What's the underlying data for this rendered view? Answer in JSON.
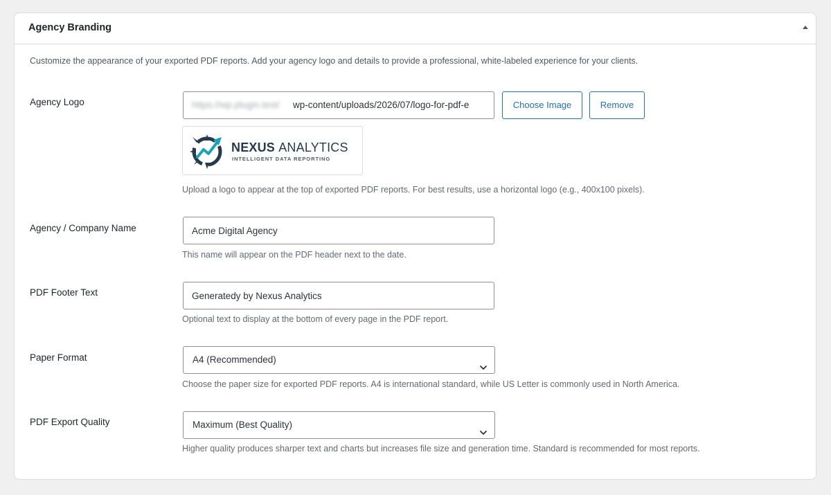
{
  "panel": {
    "title": "Agency Branding",
    "intro": "Customize the appearance of your exported PDF reports. Add your agency logo and details to provide a professional, white-labeled experience for your clients."
  },
  "agency_logo": {
    "label": "Agency Logo",
    "url_blurred": "https://wp.plugin.test/",
    "url_visible": "wp-content/uploads/2026/07/logo-for-pdf-e",
    "choose_button": "Choose Image",
    "remove_button": "Remove",
    "logo": {
      "name_bold": "NEXUS",
      "name_light": "ANALYTICS",
      "tagline": "INTELLIGENT DATA REPORTING"
    },
    "help": "Upload a logo to appear at the top of exported PDF reports. For best results, use a horizontal logo (e.g., 400x100 pixels)."
  },
  "company_name": {
    "label": "Agency / Company Name",
    "value": "Acme Digital Agency",
    "help": "This name will appear on the PDF header next to the date."
  },
  "footer_text": {
    "label": "PDF Footer Text",
    "value": "Generatedy by Nexus Analytics",
    "help": "Optional text to display at the bottom of every page in the PDF report."
  },
  "paper_format": {
    "label": "Paper Format",
    "selected": "A4 (Recommended)",
    "help": "Choose the paper size for exported PDF reports. A4 is international standard, while US Letter is commonly used in North America."
  },
  "export_quality": {
    "label": "PDF Export Quality",
    "selected": "Maximum (Best Quality)",
    "help": "Higher quality produces sharper text and charts but increases file size and generation time. Standard is recommended for most reports."
  },
  "colors": {
    "accent": "#2271b1",
    "logo_teal": "#1aa3b5",
    "logo_navy": "#263a4c"
  }
}
